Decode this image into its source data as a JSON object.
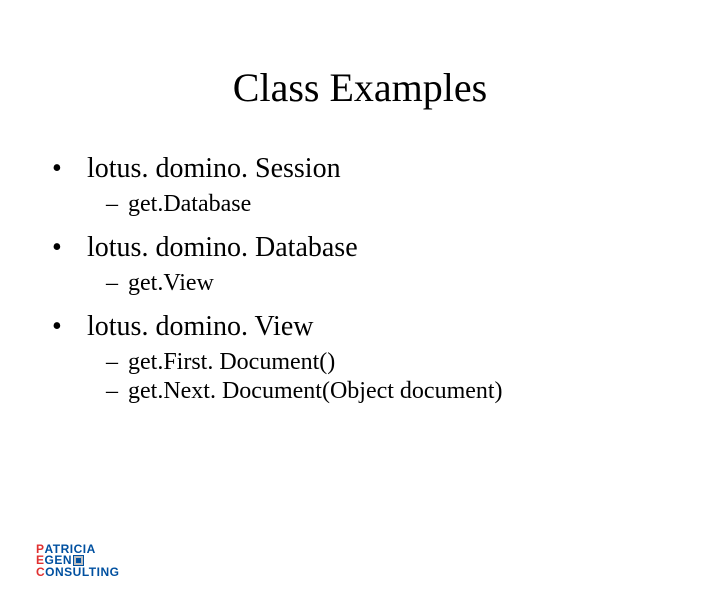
{
  "title": "Class Examples",
  "items": [
    {
      "label": "lotus. domino. Session",
      "sub": [
        "get.Database"
      ]
    },
    {
      "label": "lotus. domino. Database",
      "sub": [
        "get.View"
      ]
    },
    {
      "label": "lotus. domino. View",
      "sub": [
        "get.First. Document()",
        "get.Next. Document(Object document)"
      ]
    }
  ],
  "logo": {
    "line1_first": "P",
    "line1_rest": "ATRICIA",
    "line2_first": "E",
    "line2_rest": "GEN",
    "line3_first": "C",
    "line3_rest": "ONSULTING"
  }
}
